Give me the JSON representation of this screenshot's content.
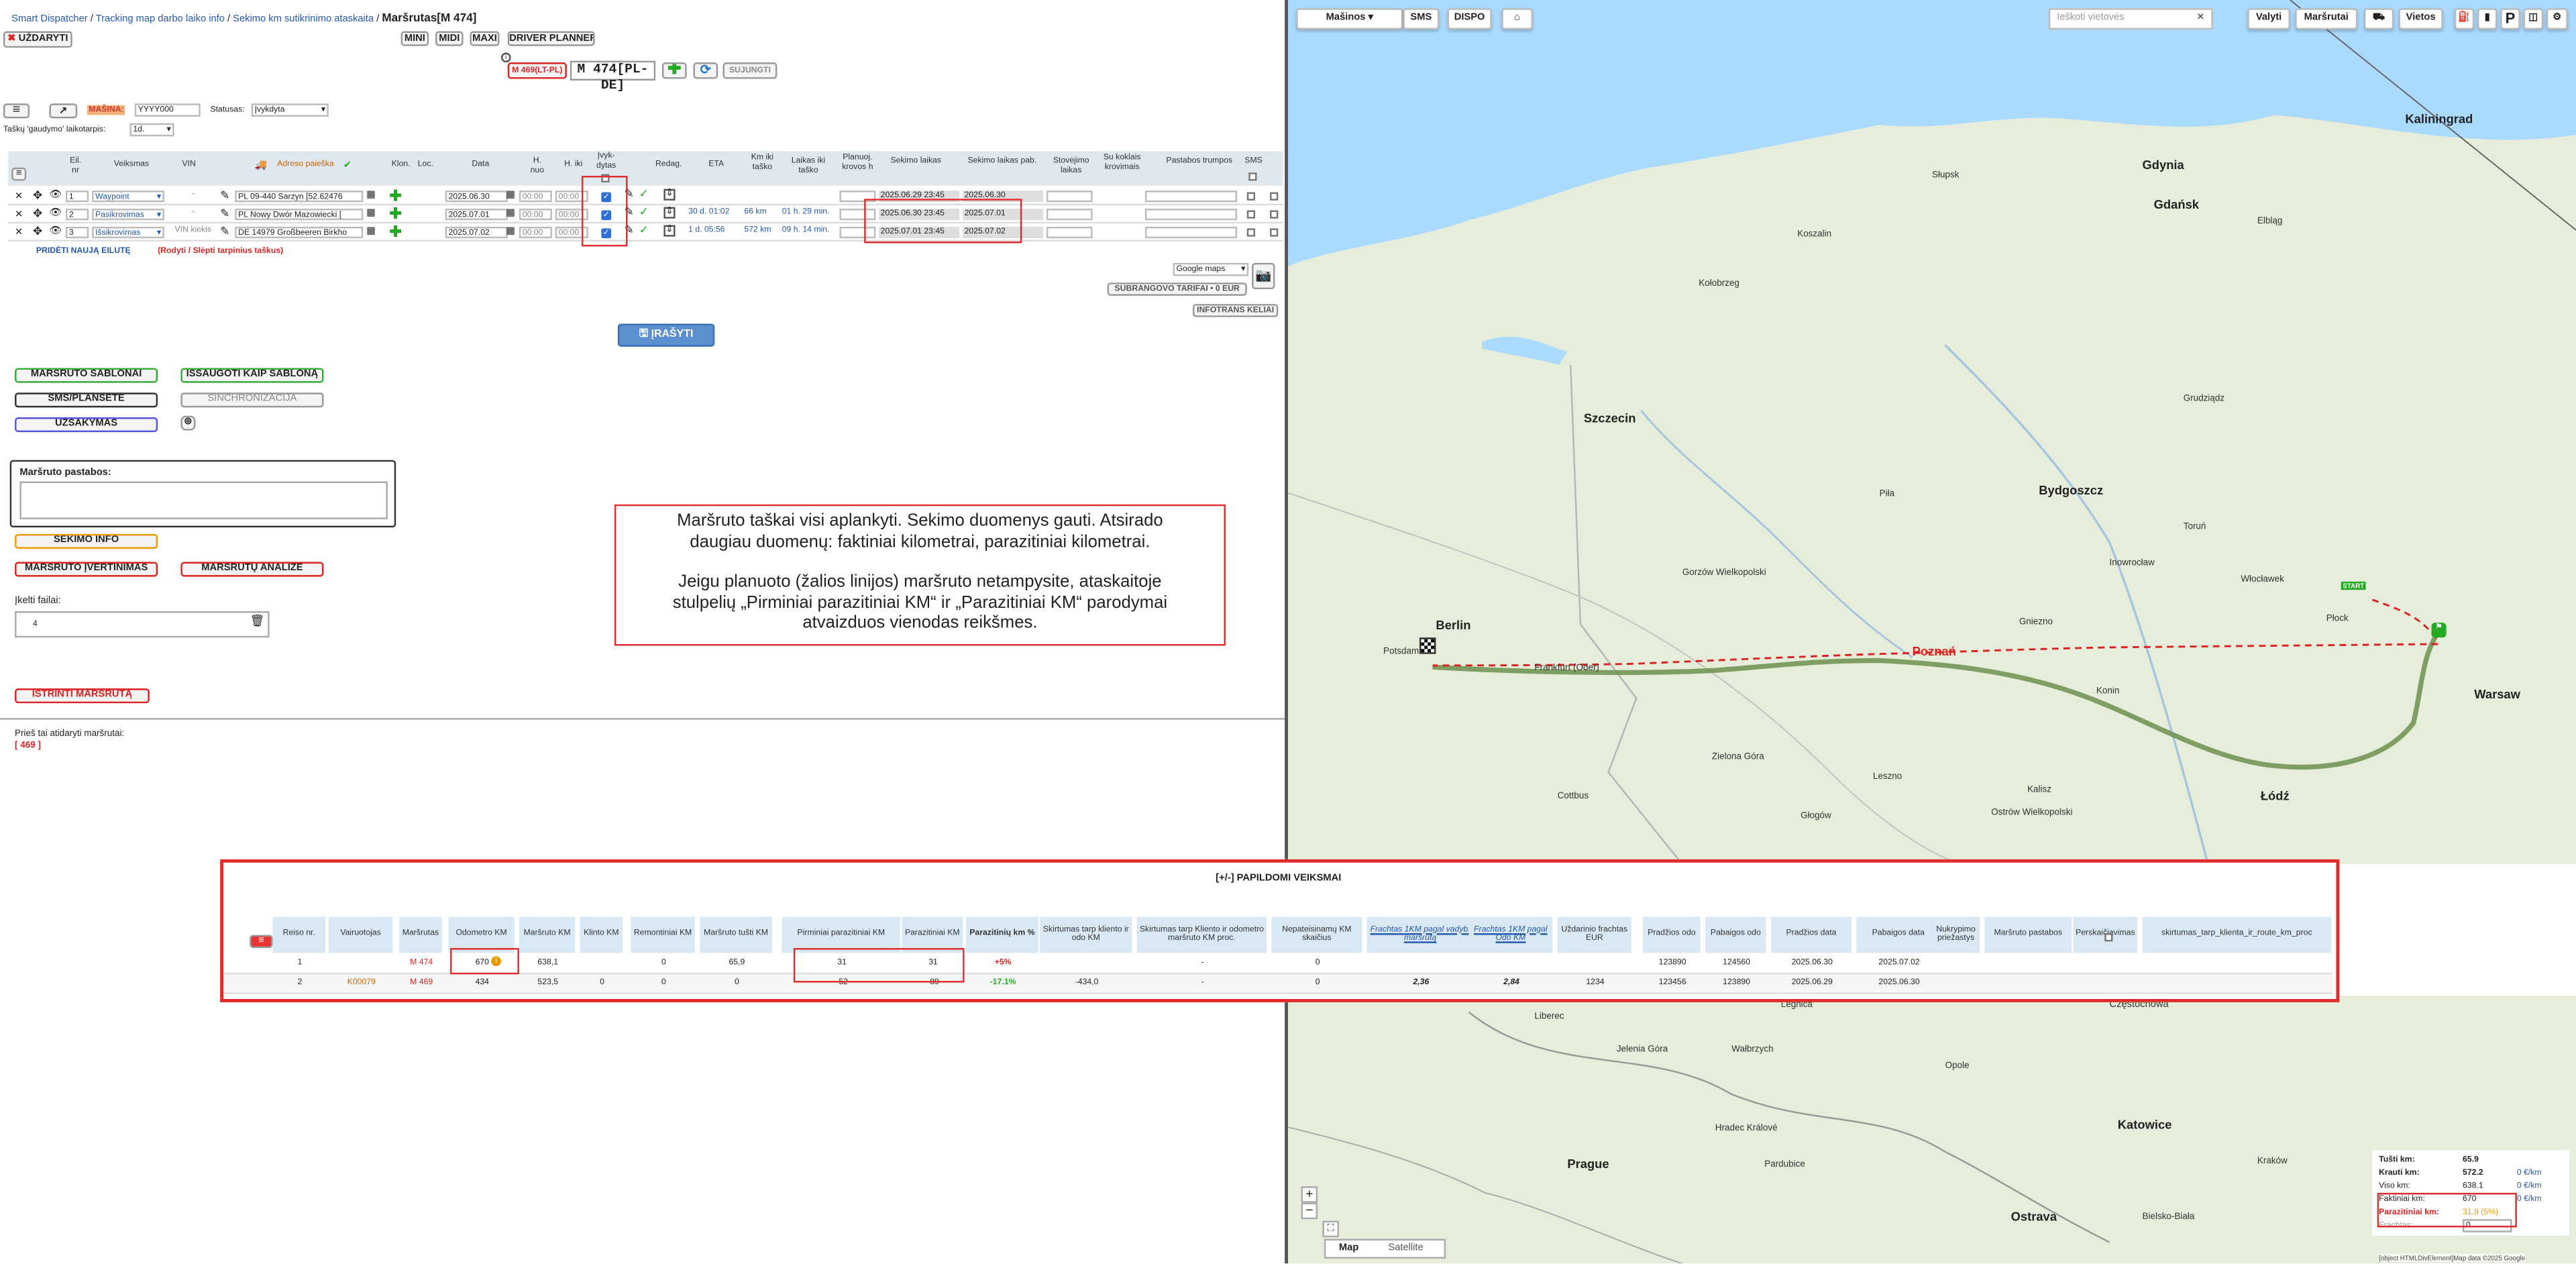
{
  "breadcrumb": {
    "home": "Smart Dispatcher",
    "sep": "/",
    "link1": "Tracking map darbo laiko info",
    "link2": "Sekimo km sutikrinimo ataskaita",
    "current": "Maršrutas[M 474]"
  },
  "top": {
    "close": "UŽDARYTI",
    "mini": "MINI",
    "midi": "MIDI",
    "maxi": "MAXI",
    "driver_planner": "DRIVER PLANNER",
    "prev_route": "M 469(LT-PL)",
    "route_title": "M 474[PL-DE]",
    "join": "SUJUNGTI",
    "info_mark": "i"
  },
  "filters": {
    "masina_label": "MAŠINA:",
    "masina_value": "YYYY000",
    "status_label": "Statusas:",
    "status_value": "Įvykdyta",
    "catch_label": "Taškų 'gaudymo' laikotarpis:",
    "catch_value": "1d."
  },
  "stops_header": {
    "eil": "Eil. nr",
    "veiksmas": "Veiksmas",
    "vin": "VIN",
    "adresas": "Adreso paieška",
    "klon": "Klon.",
    "loc": "Loc.",
    "data": "Data",
    "h_nuo": "H. nuo",
    "h_iki": "H. iki",
    "ivykdytas": "Įvyk-dytas",
    "redag": "Redag.",
    "eta": "ETA",
    "km_iki": "Km iki taško",
    "laikas_iki": "Laikas iki taško",
    "planuoj": "Planuoj. krovos h",
    "sekimo_laikas": "Sekimo laikas",
    "sekimo_pab": "Sekimo laikas pab.",
    "stovejimo": "Stovėjimo laikas",
    "su_koklais": "Su koklais krovimais",
    "pastabos": "Pastabos trumpos",
    "sms": "SMS"
  },
  "stops": [
    {
      "nr": "1",
      "action": "Waypoint",
      "vin": "-",
      "address": "PL 09-440 Sarzyn  [52.62476",
      "date": "2025.06.30",
      "h_from": "00:00",
      "h_to": "00:00",
      "eta": "",
      "km": "",
      "time": "",
      "track": "2025.06.29 23:45",
      "track_end": "2025.06.30"
    },
    {
      "nr": "2",
      "action": "Pasikrovimas",
      "vin": "-",
      "address": "PL  Nowy Dwór Mazowiecki  [",
      "date": "2025.07.01",
      "h_from": "00:00",
      "h_to": "00:00",
      "eta": "30 d. 01:02",
      "km": "66 km",
      "time": "01 h. 29 min.",
      "track": "2025.06.30 23:45",
      "track_end": "2025.07.01"
    },
    {
      "nr": "3",
      "action": "Išsikrovimas",
      "vin": "VIN kiekis",
      "address": "DE 14979 Großbeeren Birkho",
      "date": "2025.07.02",
      "h_from": "00:00",
      "h_to": "00:00",
      "eta": "1 d. 05:56",
      "km": "572 km",
      "time": "09 h. 14 min.",
      "track": "2025.07.01 23:45",
      "track_end": "2025.07.02"
    }
  ],
  "stops_links": {
    "add": "PRIDĖTI NAUJĄ EILUTĘ",
    "toggle": "(Rodyti / Slėpti tarpinius taškus)"
  },
  "map_controls": {
    "select": "Google maps",
    "tariff": "SUBRANGOVO TARIFAI • 0 EUR",
    "infotrans": "INFOTRANS KELIAI"
  },
  "save": "ĮRAŠYTI",
  "actions": {
    "templates": "MARŠRUTO ŠABLONAI",
    "save_template": "IŠSAUGOTI KAIP ŠABLONĄ",
    "sms": "SMS/PLANŠETĖ",
    "sync": "SINCHRONIZACIJA",
    "orders": "UŽSAKYMAS",
    "notes_label": "Maršruto pastabos:",
    "tracking_info": "SEKIMO INFO",
    "evaluation": "MARŠRUTO ĮVERTINIMAS",
    "analysis": "MARŠRUTŲ ANALIZĖ",
    "upload_label": "Įkelti failai:",
    "upload_count": "4",
    "delete": "IŠTRINTI MARŠRUTĄ",
    "prev_opened": "Prieš tai atidaryti maršrutai:",
    "prev_route": "[ 469 ]"
  },
  "note": {
    "line1": "Maršruto taškai visi aplankyti. Sekimo duomenys gauti. Atsirado",
    "line2": "daugiau duomenų: faktiniai kilometrai, parazitiniai kilometrai.",
    "line3": "Jeigu planuoto (žalios linijos) maršruto netampysite, ataskaitoje",
    "line4": "stulpelių „Pirminiai parazitiniai KM“ ir „Parazitiniai KM“ parodymai",
    "line5": "atvaizduos vienodas reikšmes."
  },
  "map": {
    "cars": "Mašinos",
    "sms": "SMS",
    "dispo": "DISPO",
    "search_placeholder": "Ieškoti vietovės",
    "valyti": "Valyti",
    "marsrutai": "Maršrutai",
    "vietos": "Vietos",
    "p": "P",
    "tab_map": "Map",
    "tab_satellite": "Satellite",
    "footer": "[object HTMLDivElement]Map data ©2025 Google",
    "cities": [
      "Kaliningrad",
      "Gdynia",
      "Gdańsk",
      "Słupsk",
      "Szczecin",
      "Bydgoszcz",
      "Toruń",
      "Płock",
      "Gorzów Wielkopolski",
      "Berlin",
      "Potsdam",
      "Poznań",
      "Konin",
      "Warsaw",
      "Łódź",
      "Zielona Góra",
      "Leszno",
      "Kalisz",
      "Cottbus",
      "Głogów",
      "Ostrów Wielkopolski",
      "Włocławek",
      "Grudziądz",
      "Elbląg",
      "Koszalin",
      "Kołobrzeg",
      "Gniezno",
      "Piła",
      "Inowrocław",
      "Wałbrzych",
      "Częstochowa",
      "Liberec",
      "Prague",
      "Hradec Králové",
      "Pardubice",
      "Opole",
      "Katowice",
      "Ostrava",
      "Bielsko-Biała",
      "Kraków",
      "Jelenia Góra",
      "Legnica",
      "Frankfurt (Oder)"
    ],
    "start_label": "START",
    "stats": {
      "empty_label": "Tušti km:",
      "empty": "65.9",
      "loaded_label": "Krauti km:",
      "loaded": "572.2",
      "all_label": "Viso km:",
      "all": "638.1",
      "actual_label": "Faktiniai km:",
      "actual": "670",
      "parasitic_label": "Parazitiniai km:",
      "parasitic": "31.9 (5%)",
      "freight_label": "Frachtas:",
      "freight": "0",
      "eur_km1": "0 €/km",
      "eur_km2": "0 €/km",
      "eur_km3": "0 €/km"
    }
  },
  "extra": {
    "title": "[+/-] PAPILDOMI VEIKSMAI",
    "headers": [
      "Reiso nr.",
      "Vairuotojas",
      "Maršrutas",
      "Odometro KM",
      "Maršruto KM",
      "Klinto KM",
      "Remontiniai KM",
      "Maršruto tušti KM",
      "Pirminiai parazitiniai KM",
      "Parazitiniai KM",
      "Parazitinių km %",
      "Skirtumas tarp kliento ir odo KM",
      "Skirtumas tarp Kliento ir odometro maršruto KM proc.",
      "Nepateisinamų KM skaičius",
      "Frachtas 1KM pagal vadyb. maršrutą",
      "Frachtas 1KM pagal Odo KM",
      "Uždarinio frachtas EUR",
      "Pradžios odo",
      "Pabaigos odo",
      "Pradžios data",
      "Pabaigos data",
      "Nukrypimo priežastys",
      "Maršruto pastabos",
      "Perskaičiavimas",
      "skirtumas_tarp_klienta_ir_route_km_proc"
    ],
    "rows": [
      [
        "1",
        "",
        "M 474",
        "670",
        "638,1",
        "",
        "0",
        "65,9",
        "31",
        "31",
        "+5%",
        "",
        "-",
        "0",
        "",
        "",
        "",
        "123890",
        "124560",
        "2025.06.30",
        "2025.07.02",
        "",
        "",
        "",
        ""
      ],
      [
        "2",
        "K00079",
        "M 469",
        "434",
        "523,5",
        "0",
        "0",
        "0",
        "-52",
        "-89",
        "-17.1%",
        "-434,0",
        "-",
        "0",
        "2,36",
        "2,84",
        "1234",
        "123456",
        "123890",
        "2025.06.29",
        "2025.06.30",
        "",
        "",
        "",
        ""
      ]
    ]
  },
  "colors": {
    "accent_red": "#e32b2b",
    "route_green": "#6b8f4e",
    "blue_link": "#2458a8"
  }
}
